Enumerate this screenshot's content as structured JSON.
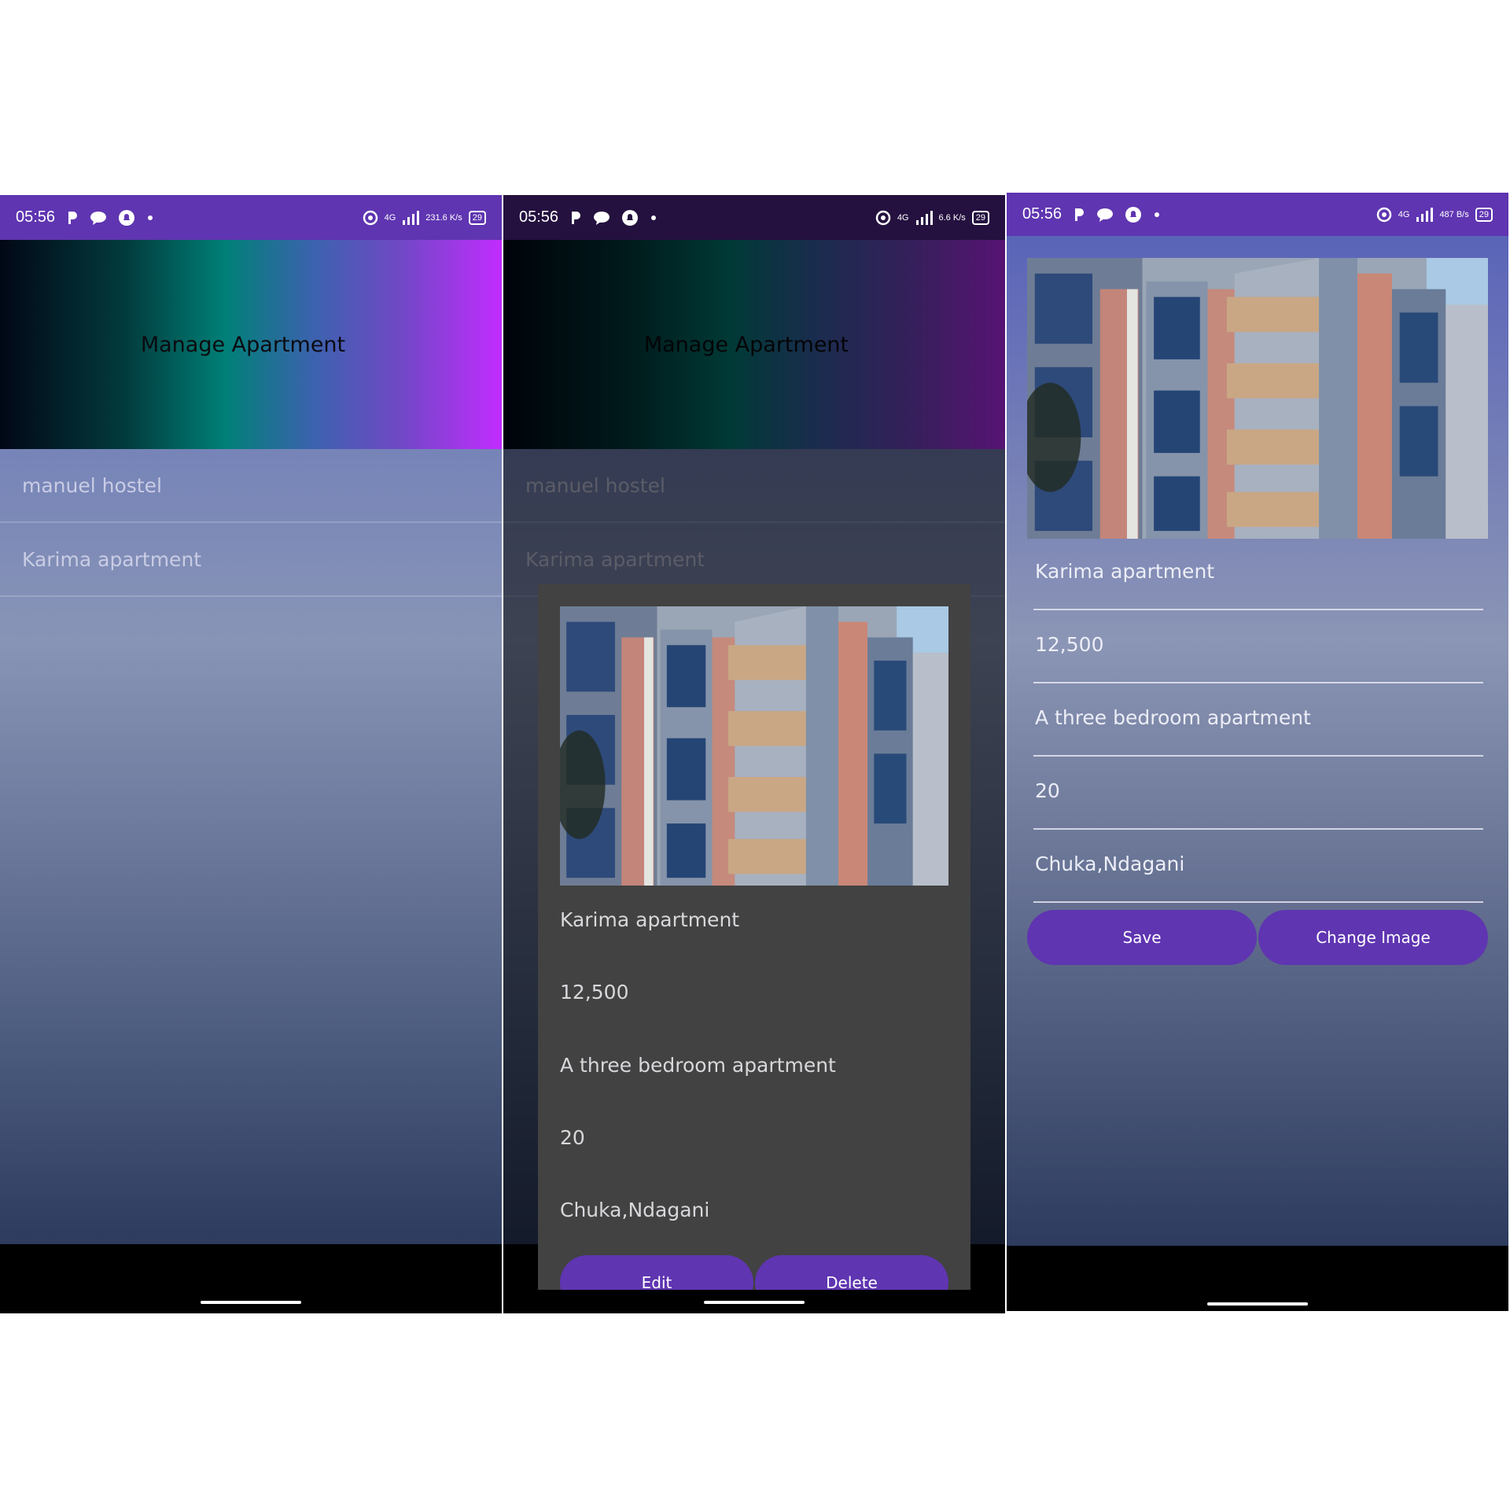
{
  "status_bar": {
    "time": "05:56",
    "left_icons": [
      "parking-icon",
      "chat-bubble-icon",
      "notification-bell-icon",
      "dot-icon"
    ],
    "network": "4G",
    "battery": "29",
    "speeds": [
      "231.6 K/s",
      "6.6 K/s",
      "487 B/s"
    ]
  },
  "screen_list": {
    "title": "Manage Apartment",
    "items": [
      {
        "label": "manuel hostel"
      },
      {
        "label": "Karima apartment"
      }
    ]
  },
  "dialog": {
    "name": "Karima apartment",
    "price": "12,500",
    "description": "A three bedroom apartment",
    "units": "20",
    "location": "Chuka,Ndagani",
    "edit_label": "Edit",
    "delete_label": "Delete"
  },
  "edit_form": {
    "name": "Karima apartment",
    "price": "12,500",
    "description": "A three bedroom apartment",
    "units": "20",
    "location": "Chuka,Ndagani",
    "save_label": "Save",
    "change_image_label": "Change Image"
  },
  "colors": {
    "accent": "#5f35b1",
    "dialog_bg": "#424242"
  }
}
